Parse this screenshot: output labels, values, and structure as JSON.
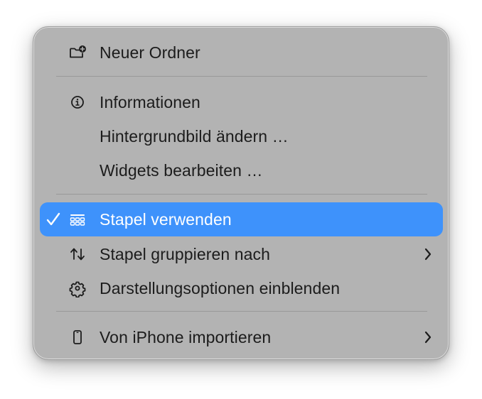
{
  "menu": {
    "items": [
      {
        "label": "Neuer Ordner",
        "icon": "new-folder-icon"
      },
      {
        "label": "Informationen",
        "icon": "info-icon"
      },
      {
        "label": "Hintergrundbild ändern …",
        "icon": ""
      },
      {
        "label": "Widgets bearbeiten …",
        "icon": ""
      },
      {
        "label": "Stapel verwenden",
        "icon": "stacks-icon",
        "checked": true,
        "selected": true
      },
      {
        "label": "Stapel gruppieren nach",
        "icon": "sort-arrows-icon",
        "submenu": true
      },
      {
        "label": "Darstellungsoptionen einblenden",
        "icon": "gear-icon"
      },
      {
        "label": "Von iPhone importieren",
        "icon": "iphone-icon",
        "submenu": true
      }
    ]
  },
  "colors": {
    "menu_background": "#b3b3b3",
    "highlight": "#3e92fb",
    "text": "#1c1c1c",
    "separator": "#999999"
  }
}
